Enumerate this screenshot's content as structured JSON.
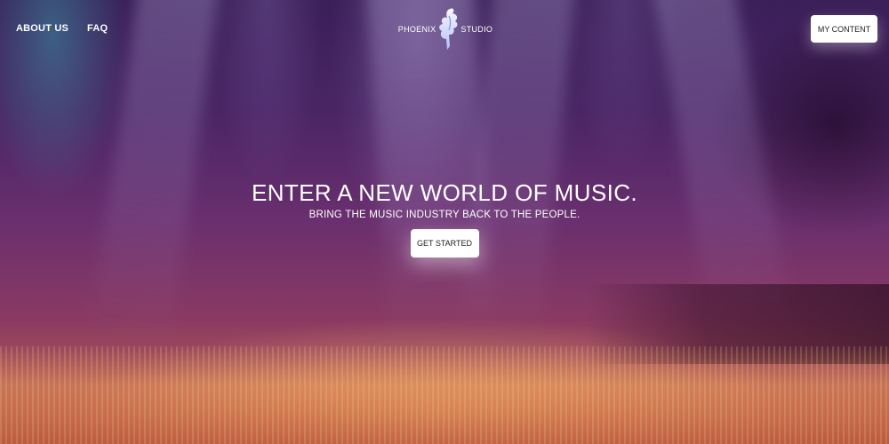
{
  "nav": {
    "links": [
      {
        "label": "ABOUT US"
      },
      {
        "label": "FAQ"
      }
    ],
    "logo": {
      "left_text": "PHOENIX",
      "right_text": "STUDIO",
      "icon": "phoenix-bird-icon"
    },
    "my_content_label": "MY CONTENT"
  },
  "hero": {
    "headline": "ENTER A NEW WORLD OF MUSIC.",
    "subhead": "BRING THE MUSIC INDUSTRY BACK TO THE PEOPLE.",
    "cta_label": "GET STARTED",
    "background": "concert-crowd-stage-lights-image"
  },
  "colors": {
    "button_bg": "#ffffff",
    "button_text": "#222222",
    "nav_text": "#ffffff"
  }
}
